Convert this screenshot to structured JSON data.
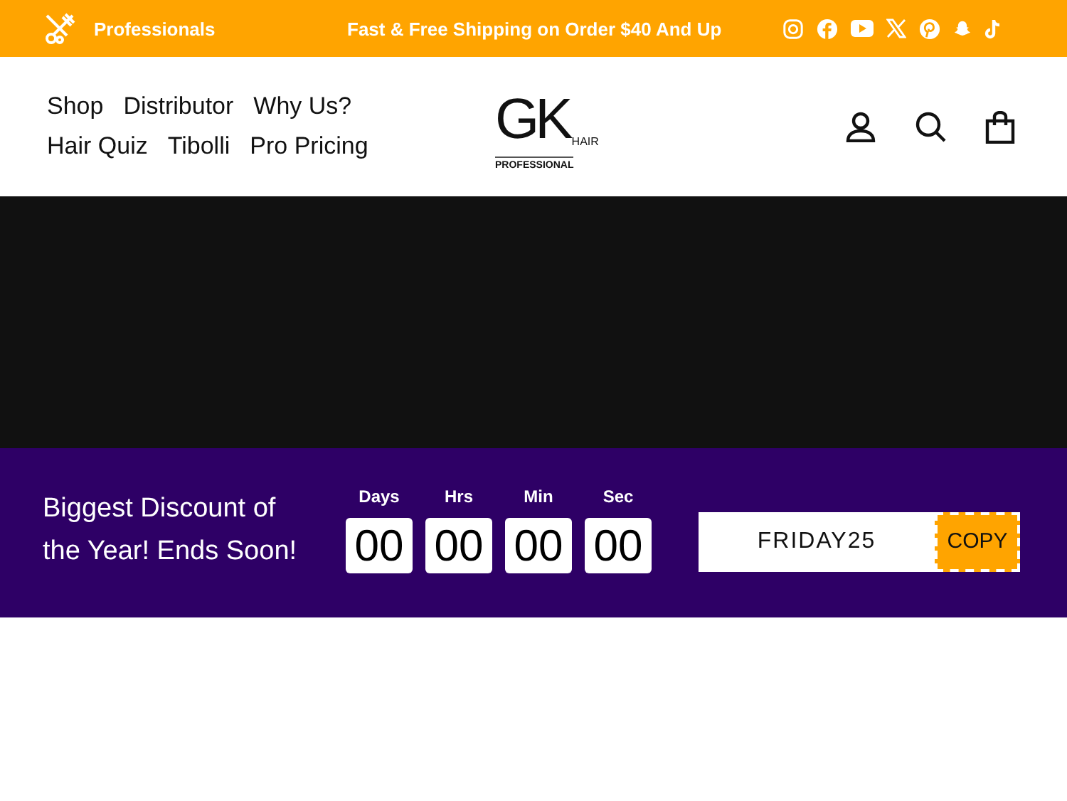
{
  "top_bar": {
    "brand_label": "Professionals",
    "shipping_message": "Fast & Free Shipping on Order $40 And Up"
  },
  "nav": {
    "rows": [
      [
        "Shop",
        "Distributor",
        "Why Us?"
      ],
      [
        "Hair Quiz",
        "Tibolli",
        "Pro Pricing"
      ]
    ]
  },
  "logo": {
    "mark": "GK",
    "sub": "HAIR",
    "tagline": "PROFESSIONAL"
  },
  "hero": {
    "kind": "video"
  },
  "promo": {
    "headline": "Biggest Discount of the Year! Ends Soon!",
    "countdown": [
      {
        "label": "Days",
        "value": "00"
      },
      {
        "label": "Hrs",
        "value": "00"
      },
      {
        "label": "Min",
        "value": "00"
      },
      {
        "label": "Sec",
        "value": "00"
      }
    ],
    "code": "FRIDAY25",
    "copy_button": "COPY"
  }
}
